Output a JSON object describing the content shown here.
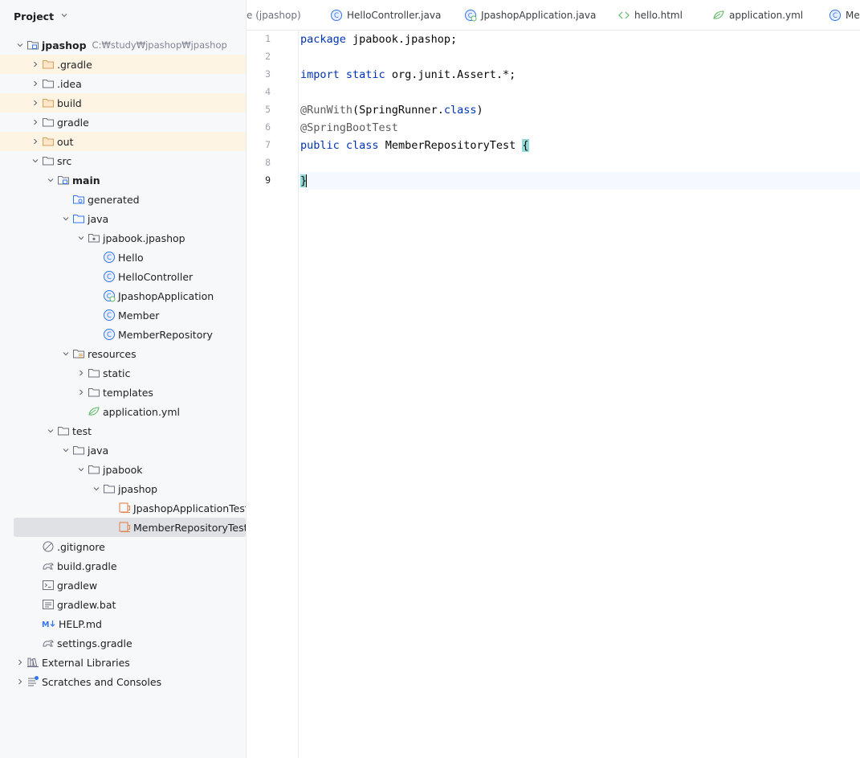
{
  "sidebar": {
    "title": "Project",
    "tree": [
      {
        "label": "jpashop",
        "path": "C:₩study₩jpashop₩jpashop",
        "depth": 0,
        "arrow": "down",
        "icon": "module-folder-icon",
        "bold": true,
        "hl": false
      },
      {
        "label": ".gradle",
        "depth": 1,
        "arrow": "right",
        "icon": "folder-icon-orange",
        "hl": true
      },
      {
        "label": ".idea",
        "depth": 1,
        "arrow": "right",
        "icon": "folder-icon",
        "hl": false
      },
      {
        "label": "build",
        "depth": 1,
        "arrow": "right",
        "icon": "folder-icon-orange",
        "hl": true
      },
      {
        "label": "gradle",
        "depth": 1,
        "arrow": "right",
        "icon": "folder-icon",
        "hl": false
      },
      {
        "label": "out",
        "depth": 1,
        "arrow": "right",
        "icon": "folder-icon-orange",
        "hl": true
      },
      {
        "label": "src",
        "depth": 1,
        "arrow": "down",
        "icon": "folder-icon",
        "hl": false
      },
      {
        "label": "main",
        "depth": 2,
        "arrow": "down",
        "icon": "module-folder-icon",
        "bold": true,
        "hl": false
      },
      {
        "label": "generated",
        "depth": 3,
        "arrow": "none",
        "icon": "generated-folder-icon",
        "hl": false
      },
      {
        "label": "java",
        "depth": 3,
        "arrow": "down",
        "icon": "source-folder-icon",
        "hl": false
      },
      {
        "label": "jpabook.jpashop",
        "depth": 4,
        "arrow": "down",
        "icon": "package-icon",
        "hl": false
      },
      {
        "label": "Hello",
        "depth": 5,
        "arrow": "none",
        "icon": "class-icon",
        "hl": false
      },
      {
        "label": "HelloController",
        "depth": 5,
        "arrow": "none",
        "icon": "class-icon",
        "hl": false
      },
      {
        "label": "JpashopApplication",
        "depth": 5,
        "arrow": "none",
        "icon": "spring-class-icon",
        "hl": false
      },
      {
        "label": "Member",
        "depth": 5,
        "arrow": "none",
        "icon": "class-icon",
        "hl": false
      },
      {
        "label": "MemberRepository",
        "depth": 5,
        "arrow": "none",
        "icon": "class-icon",
        "hl": false
      },
      {
        "label": "resources",
        "depth": 3,
        "arrow": "down",
        "icon": "resources-folder-icon",
        "hl": false
      },
      {
        "label": "static",
        "depth": 4,
        "arrow": "right",
        "icon": "folder-icon",
        "hl": false
      },
      {
        "label": "templates",
        "depth": 4,
        "arrow": "right",
        "icon": "folder-icon",
        "hl": false
      },
      {
        "label": "application.yml",
        "depth": 4,
        "arrow": "none",
        "icon": "spring-yml-icon",
        "hl": false
      },
      {
        "label": "test",
        "depth": 2,
        "arrow": "down",
        "icon": "folder-icon",
        "hl": false
      },
      {
        "label": "java",
        "depth": 3,
        "arrow": "down",
        "icon": "folder-icon",
        "hl": false
      },
      {
        "label": "jpabook",
        "depth": 4,
        "arrow": "down",
        "icon": "folder-icon",
        "hl": false
      },
      {
        "label": "jpashop",
        "depth": 5,
        "arrow": "down",
        "icon": "folder-icon",
        "hl": false
      },
      {
        "label": "JpashopApplicationTests.j",
        "depth": 6,
        "arrow": "none",
        "icon": "test-class-icon",
        "hl": false
      },
      {
        "label": "MemberRepositoryTest.ja",
        "depth": 6,
        "arrow": "none",
        "icon": "test-class-icon",
        "hl": false,
        "selected": true
      },
      {
        "label": ".gitignore",
        "depth": 1,
        "arrow": "none",
        "icon": "ignore-file-icon",
        "hl": false
      },
      {
        "label": "build.gradle",
        "depth": 1,
        "arrow": "none",
        "icon": "gradle-icon",
        "hl": false
      },
      {
        "label": "gradlew",
        "depth": 1,
        "arrow": "none",
        "icon": "terminal-file-icon",
        "hl": false
      },
      {
        "label": "gradlew.bat",
        "depth": 1,
        "arrow": "none",
        "icon": "text-file-icon",
        "hl": false
      },
      {
        "label": "HELP.md",
        "depth": 1,
        "arrow": "none",
        "icon": "markdown-icon",
        "hl": false
      },
      {
        "label": "settings.gradle",
        "depth": 1,
        "arrow": "none",
        "icon": "gradle-icon",
        "hl": false
      },
      {
        "label": "External Libraries",
        "depth": 0,
        "arrow": "right",
        "icon": "library-icon",
        "hl": false
      },
      {
        "label": "Scratches and Consoles",
        "depth": 0,
        "arrow": "right",
        "icon": "scratches-icon",
        "hl": false
      }
    ]
  },
  "tabs": [
    {
      "label": "e (jpashop)",
      "icon": "none"
    },
    {
      "label": "HelloController.java",
      "icon": "class-icon"
    },
    {
      "label": "JpashopApplication.java",
      "icon": "spring-class-icon"
    },
    {
      "label": "hello.html",
      "icon": "html-icon"
    },
    {
      "label": "application.yml",
      "icon": "spring-yml-icon"
    },
    {
      "label": "Mem",
      "icon": "class-icon"
    }
  ],
  "editor": {
    "line_numbers": [
      "1",
      "2",
      "3",
      "4",
      "5",
      "6",
      "7",
      "8",
      "9"
    ],
    "current_line": 9,
    "lines": [
      [
        {
          "t": "package",
          "c": "kw"
        },
        {
          "t": " jpabook.jpashop;",
          "c": "fn"
        }
      ],
      [],
      [
        {
          "t": "import",
          "c": "kw"
        },
        {
          "t": " ",
          "c": "fn"
        },
        {
          "t": "static",
          "c": "kw"
        },
        {
          "t": " org.junit.Assert.*;",
          "c": "fn"
        }
      ],
      [],
      [
        {
          "t": "@RunWith",
          "c": "ann"
        },
        {
          "t": "(SpringRunner.",
          "c": "fn"
        },
        {
          "t": "class",
          "c": "kw"
        },
        {
          "t": ")",
          "c": "fn"
        }
      ],
      [
        {
          "t": "@SpringBootTest",
          "c": "ann"
        }
      ],
      [
        {
          "t": "public",
          "c": "kw"
        },
        {
          "t": " ",
          "c": "fn"
        },
        {
          "t": "class",
          "c": "kw"
        },
        {
          "t": " MemberRepositoryTest ",
          "c": "fn"
        },
        {
          "t": "{",
          "c": "brace-hl"
        }
      ],
      [],
      [
        {
          "t": "}",
          "c": "brace-hl"
        }
      ]
    ]
  },
  "colors": {
    "accent": "#3574f0",
    "highlight": "#fdf4e3",
    "selected": "#dfe1e5"
  }
}
